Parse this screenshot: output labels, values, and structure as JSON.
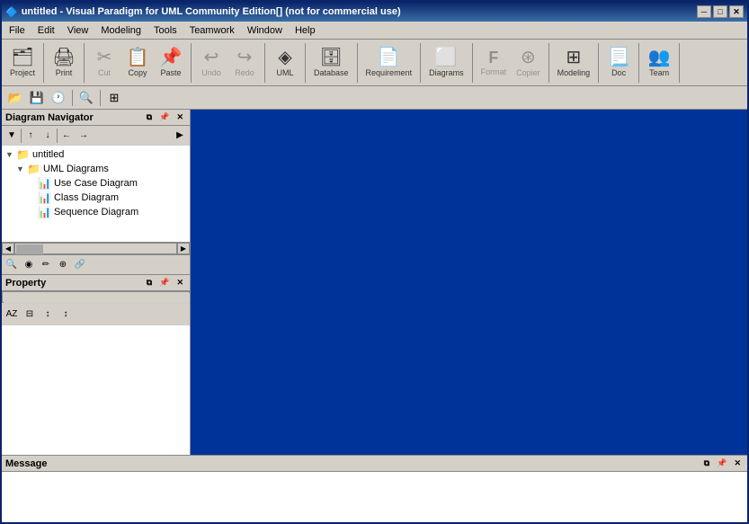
{
  "window": {
    "title": "untitled - Visual Paradigm for UML Community Edition[] (not for commercial use)",
    "icon": "🔷"
  },
  "titlebar": {
    "controls": {
      "minimize": "─",
      "maximize": "□",
      "close": "✕"
    }
  },
  "menu": {
    "items": [
      "File",
      "Edit",
      "View",
      "Modeling",
      "Tools",
      "Teamwork",
      "Window",
      "Help"
    ]
  },
  "toolbar": {
    "buttons": [
      {
        "id": "project",
        "label": "Project",
        "icon": "🗂"
      },
      {
        "id": "print",
        "label": "Print",
        "icon": "🖨"
      },
      {
        "id": "cut",
        "label": "Cut",
        "icon": "✂",
        "disabled": true
      },
      {
        "id": "copy",
        "label": "Copy",
        "icon": "📋",
        "disabled": false
      },
      {
        "id": "paste",
        "label": "Paste",
        "icon": "📌",
        "disabled": false
      },
      {
        "id": "undo",
        "label": "Undo",
        "icon": "↩",
        "disabled": true
      },
      {
        "id": "redo",
        "label": "Redo",
        "icon": "↪",
        "disabled": true
      },
      {
        "id": "uml",
        "label": "UML",
        "icon": "◈"
      },
      {
        "id": "database",
        "label": "Database",
        "icon": "🗄"
      },
      {
        "id": "requirement",
        "label": "Requirement",
        "icon": "📄"
      },
      {
        "id": "diagrams",
        "label": "Diagrams",
        "icon": "⬜"
      },
      {
        "id": "format",
        "label": "Format",
        "icon": "F",
        "disabled": true
      },
      {
        "id": "copier",
        "label": "Copier",
        "icon": "⊛",
        "disabled": true
      },
      {
        "id": "modeling",
        "label": "Modeling",
        "icon": "⊞"
      },
      {
        "id": "doc",
        "label": "Doc",
        "icon": "📃"
      },
      {
        "id": "team",
        "label": "Team",
        "icon": "👥"
      }
    ]
  },
  "diagrams_navigator": {
    "title": "Diagram Navigator",
    "items": [
      {
        "type": "project",
        "label": "untitled",
        "level": 0,
        "expanded": true
      },
      {
        "type": "folder",
        "label": "UML Diagrams",
        "level": 1,
        "expanded": true
      },
      {
        "type": "diagram",
        "label": "Use Case Diagram",
        "level": 2
      },
      {
        "type": "diagram",
        "label": "Class Diagram",
        "level": 2
      },
      {
        "type": "diagram",
        "label": "Sequence Diagram",
        "level": 2
      }
    ]
  },
  "property": {
    "title": "Property"
  },
  "message": {
    "title": "Message"
  },
  "canvas": {
    "background": "#003399"
  }
}
